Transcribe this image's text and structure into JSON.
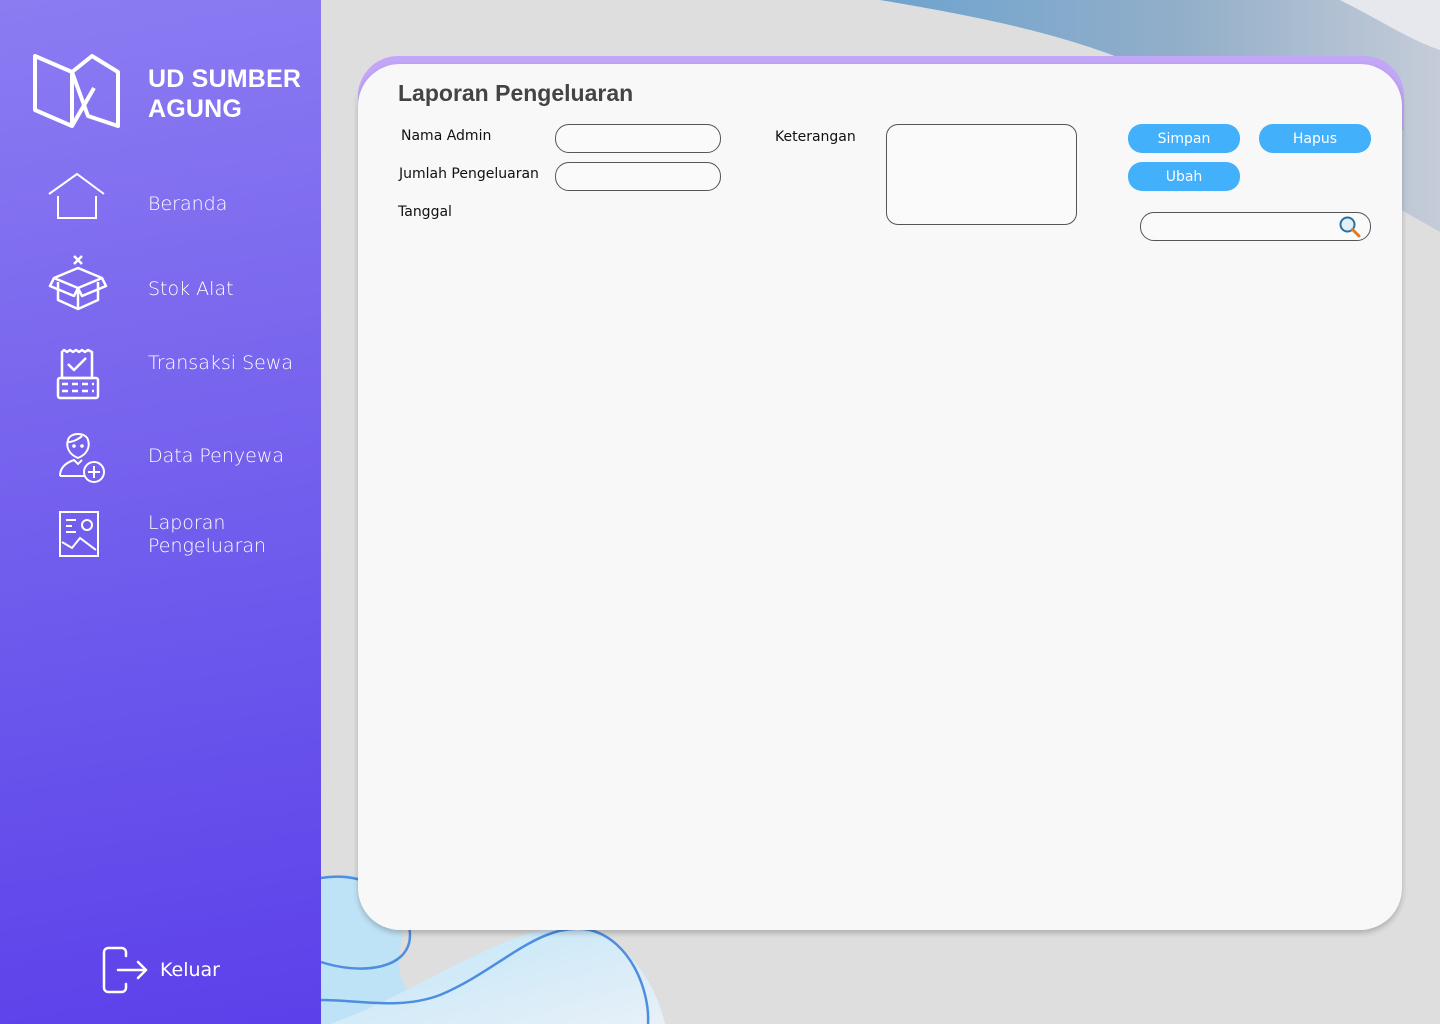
{
  "brand": {
    "name": "UD SUMBER AGUNG",
    "logo_icon": "brand-logo-icon"
  },
  "sidebar": {
    "items": [
      {
        "label": "Beranda",
        "icon": "home-icon"
      },
      {
        "label": "Stok Alat",
        "icon": "box-icon"
      },
      {
        "label": "Transaksi Sewa",
        "icon": "receipt-icon"
      },
      {
        "label": "Data Penyewa",
        "icon": "user-add-icon"
      },
      {
        "label": "Laporan Pengeluaran",
        "icon": "report-icon"
      }
    ],
    "logout": {
      "label": "Keluar",
      "icon": "logout-icon"
    }
  },
  "form": {
    "title": "Laporan Pengeluaran",
    "labels": {
      "nama_admin": "Nama Admin",
      "jumlah_pengeluaran": "Jumlah Pengeluaran",
      "tanggal": "Tanggal",
      "keterangan": "Keterangan"
    },
    "values": {
      "nama_admin": "",
      "jumlah_pengeluaran": "",
      "keterangan": "",
      "search": ""
    },
    "buttons": {
      "simpan": "Simpan",
      "hapus": "Hapus",
      "ubah": "Ubah"
    }
  },
  "colors": {
    "sidebar_top": "#8b7cf2",
    "sidebar_bottom": "#5c40ea",
    "card_accent": "#c3a6f7",
    "button": "#43b0fb",
    "card": "#f8f8f8",
    "page_bg": "#dedede"
  }
}
